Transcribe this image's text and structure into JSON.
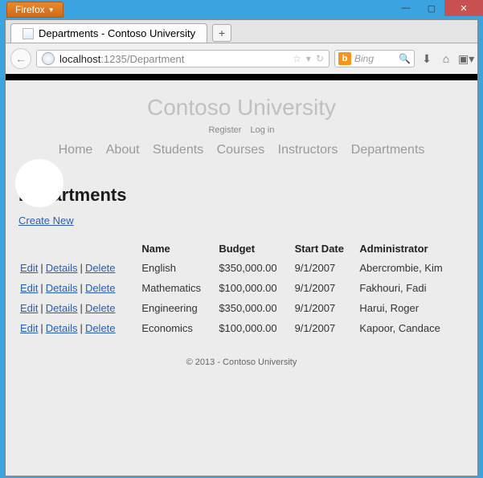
{
  "win": {
    "firefox": "Firefox"
  },
  "tab": {
    "title": "Departments - Contoso University"
  },
  "url": {
    "host": "localhost",
    "rest": ":1235/Department"
  },
  "search": {
    "placeholder": "Bing"
  },
  "site": {
    "title": "Contoso University",
    "auth": {
      "register": "Register",
      "login": "Log in"
    },
    "nav": [
      "Home",
      "About",
      "Students",
      "Courses",
      "Instructors",
      "Departments"
    ]
  },
  "page": {
    "heading": "Departments",
    "create": "Create New",
    "actions": {
      "edit": "Edit",
      "details": "Details",
      "delete": "Delete"
    },
    "columns": {
      "name": "Name",
      "budget": "Budget",
      "start": "Start Date",
      "admin": "Administrator"
    },
    "rows": [
      {
        "name": "English",
        "budget": "$350,000.00",
        "start": "9/1/2007",
        "admin": "Abercrombie, Kim"
      },
      {
        "name": "Mathematics",
        "budget": "$100,000.00",
        "start": "9/1/2007",
        "admin": "Fakhouri, Fadi"
      },
      {
        "name": "Engineering",
        "budget": "$350,000.00",
        "start": "9/1/2007",
        "admin": "Harui, Roger"
      },
      {
        "name": "Economics",
        "budget": "$100,000.00",
        "start": "9/1/2007",
        "admin": "Kapoor, Candace"
      }
    ]
  },
  "footer": "© 2013 - Contoso University"
}
